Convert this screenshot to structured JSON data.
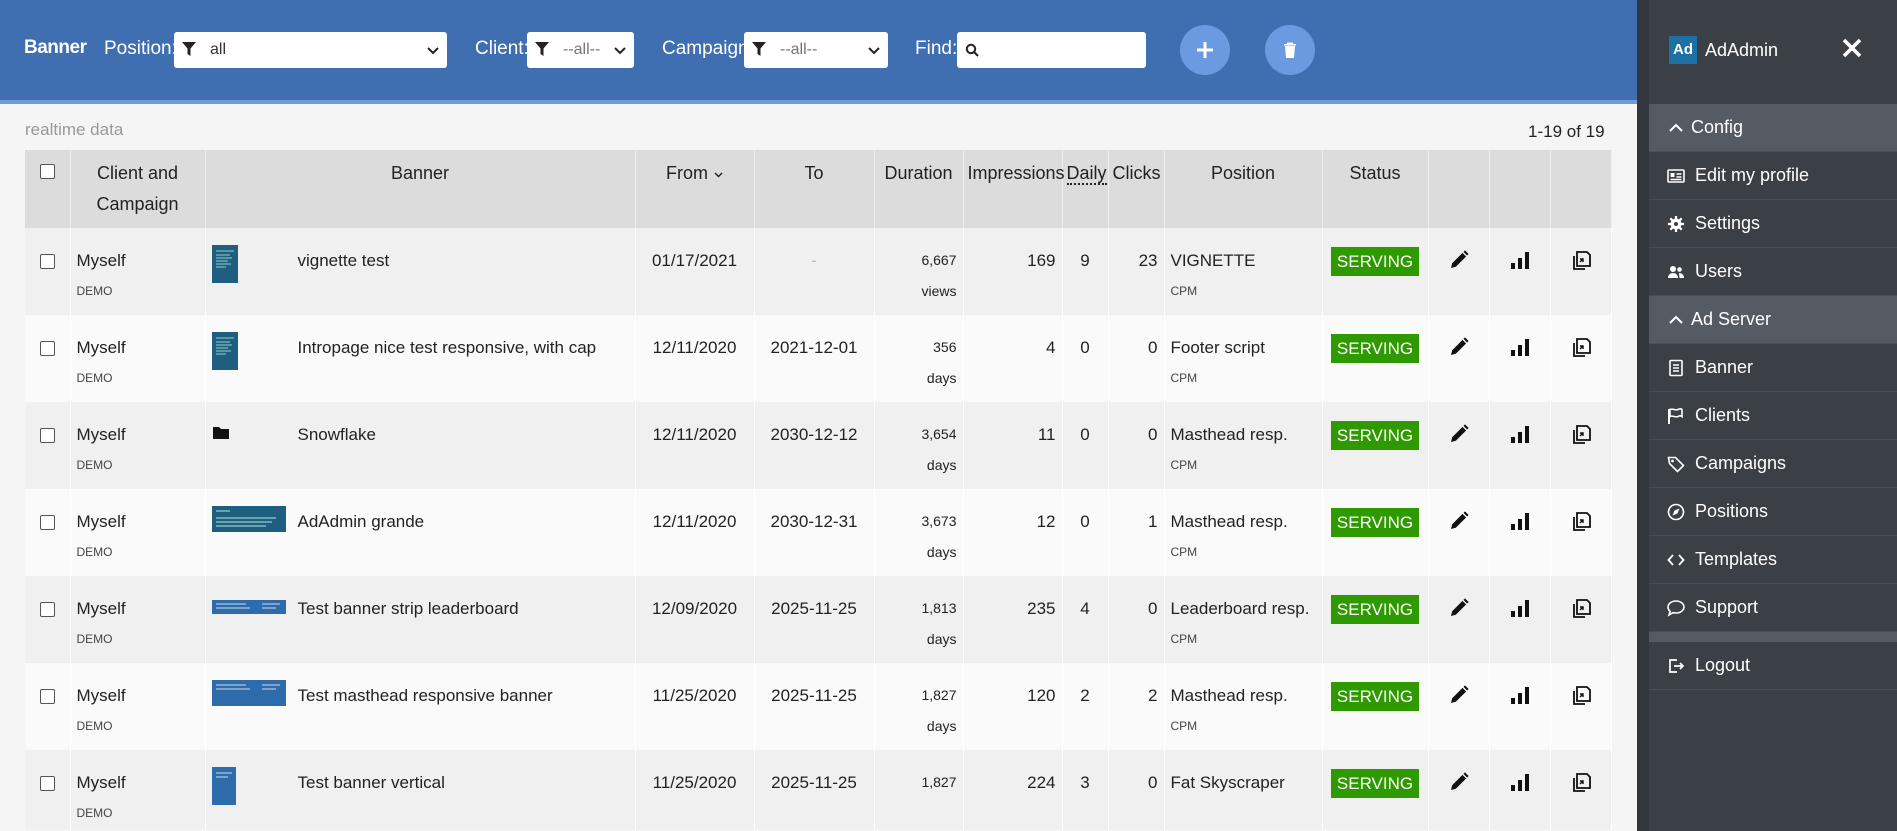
{
  "topbar": {
    "title": "Banner",
    "position_label": "Position:",
    "position_value": "all",
    "client_label": "Client:",
    "client_value": "--all--",
    "campaign_label": "Campaign:",
    "campaign_value": "--all--",
    "find_label": "Find:",
    "find_value": ""
  },
  "status_left": "realtime data",
  "status_right": "1-19 of 19",
  "table": {
    "headers": {
      "client": "Client and Campaign",
      "banner": "Banner",
      "from": "From",
      "to": "To",
      "duration": "Duration",
      "impressions": "Impressions",
      "daily": "Daily",
      "clicks": "Clicks",
      "position": "Position",
      "status": "Status"
    },
    "rows": [
      {
        "client": "Myself",
        "campaign": "DEMO",
        "banner": "vignette test",
        "from": "01/17/2021",
        "to": "-",
        "duration": "6,667 views",
        "impressions": "169",
        "daily": "9",
        "clicks": "23",
        "position": "VIGNETTE",
        "pricing": "CPM",
        "status": "SERVING"
      },
      {
        "client": "Myself",
        "campaign": "DEMO",
        "banner": "Intropage nice test responsive, with cap",
        "from": "12/11/2020",
        "to": "2021-12-01",
        "duration": "356 days",
        "impressions": "4",
        "daily": "0",
        "clicks": "0",
        "position": "Footer script",
        "pricing": "CPM",
        "status": "SERVING"
      },
      {
        "client": "Myself",
        "campaign": "DEMO",
        "banner": "Snowflake",
        "from": "12/11/2020",
        "to": "2030-12-12",
        "duration": "3,654 days",
        "impressions": "11",
        "daily": "0",
        "clicks": "0",
        "position": "Masthead resp.",
        "pricing": "CPM",
        "status": "SERVING"
      },
      {
        "client": "Myself",
        "campaign": "DEMO",
        "banner": "AdAdmin grande",
        "from": "12/11/2020",
        "to": "2030-12-31",
        "duration": "3,673 days",
        "impressions": "12",
        "daily": "0",
        "clicks": "1",
        "position": "Masthead resp.",
        "pricing": "CPM",
        "status": "SERVING"
      },
      {
        "client": "Myself",
        "campaign": "DEMO",
        "banner": "Test banner strip leaderboard",
        "from": "12/09/2020",
        "to": "2025-11-25",
        "duration": "1,813 days",
        "impressions": "235",
        "daily": "4",
        "clicks": "0",
        "position": "Leaderboard resp.",
        "pricing": "CPM",
        "status": "SERVING"
      },
      {
        "client": "Myself",
        "campaign": "DEMO",
        "banner": "Test masthead responsive banner",
        "from": "11/25/2020",
        "to": "2025-11-25",
        "duration": "1,827 days",
        "impressions": "120",
        "daily": "2",
        "clicks": "2",
        "position": "Masthead resp.",
        "pricing": "CPM",
        "status": "SERVING"
      },
      {
        "client": "Myself",
        "campaign": "DEMO",
        "banner": "Test banner vertical",
        "from": "11/25/2020",
        "to": "2025-11-25",
        "duration": "1,827",
        "impressions": "224",
        "daily": "3",
        "clicks": "0",
        "position": "Fat Skyscraper",
        "pricing": "",
        "status": "SERVING"
      }
    ]
  },
  "sidebar": {
    "logo_mark": "Ad",
    "app_name": "AdAdmin",
    "config_section": "Config",
    "config_items": [
      "Edit my profile",
      "Settings",
      "Users"
    ],
    "adserver_section": "Ad Server",
    "adserver_items": [
      "Banner",
      "Clients",
      "Campaigns",
      "Positions",
      "Templates",
      "Support"
    ],
    "logout": "Logout"
  },
  "colors": {
    "topbar": "#3f6fb0",
    "serving": "#2f9a00",
    "sidebar": "#3b3f46",
    "button": "#6b9ae0"
  }
}
